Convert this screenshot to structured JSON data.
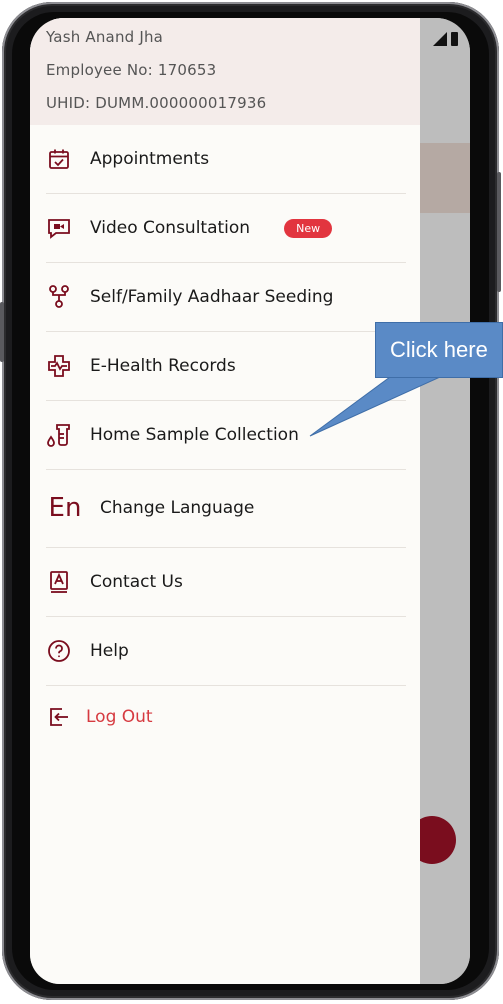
{
  "profile": {
    "name": "Yash Anand Jha",
    "employee_no": "Employee No: 170653",
    "uhid": "UHID: DUMM.000000017936"
  },
  "menu": {
    "items": [
      {
        "label": "Appointments",
        "icon": "calendar-check-icon"
      },
      {
        "label": "Video Consultation",
        "icon": "video-icon",
        "badge": "New"
      },
      {
        "label": "Self/Family Aadhaar Seeding",
        "icon": "family-tree-icon"
      },
      {
        "label": "E-Health Records",
        "icon": "health-record-icon"
      },
      {
        "label": "Home Sample Collection",
        "icon": "sample-tube-icon"
      },
      {
        "label": "Change Language",
        "icon": "language-en-icon"
      },
      {
        "label": "Contact Us",
        "icon": "contact-book-icon"
      },
      {
        "label": "Help",
        "icon": "help-circle-icon"
      }
    ],
    "logout": {
      "label": "Log Out",
      "icon": "logout-icon"
    }
  },
  "callout": {
    "text": "Click here"
  },
  "colors": {
    "brand": "#7a0d1e",
    "accent_red": "#d63a40",
    "badge": "#e2353f",
    "callout": "#5a8ac6"
  }
}
